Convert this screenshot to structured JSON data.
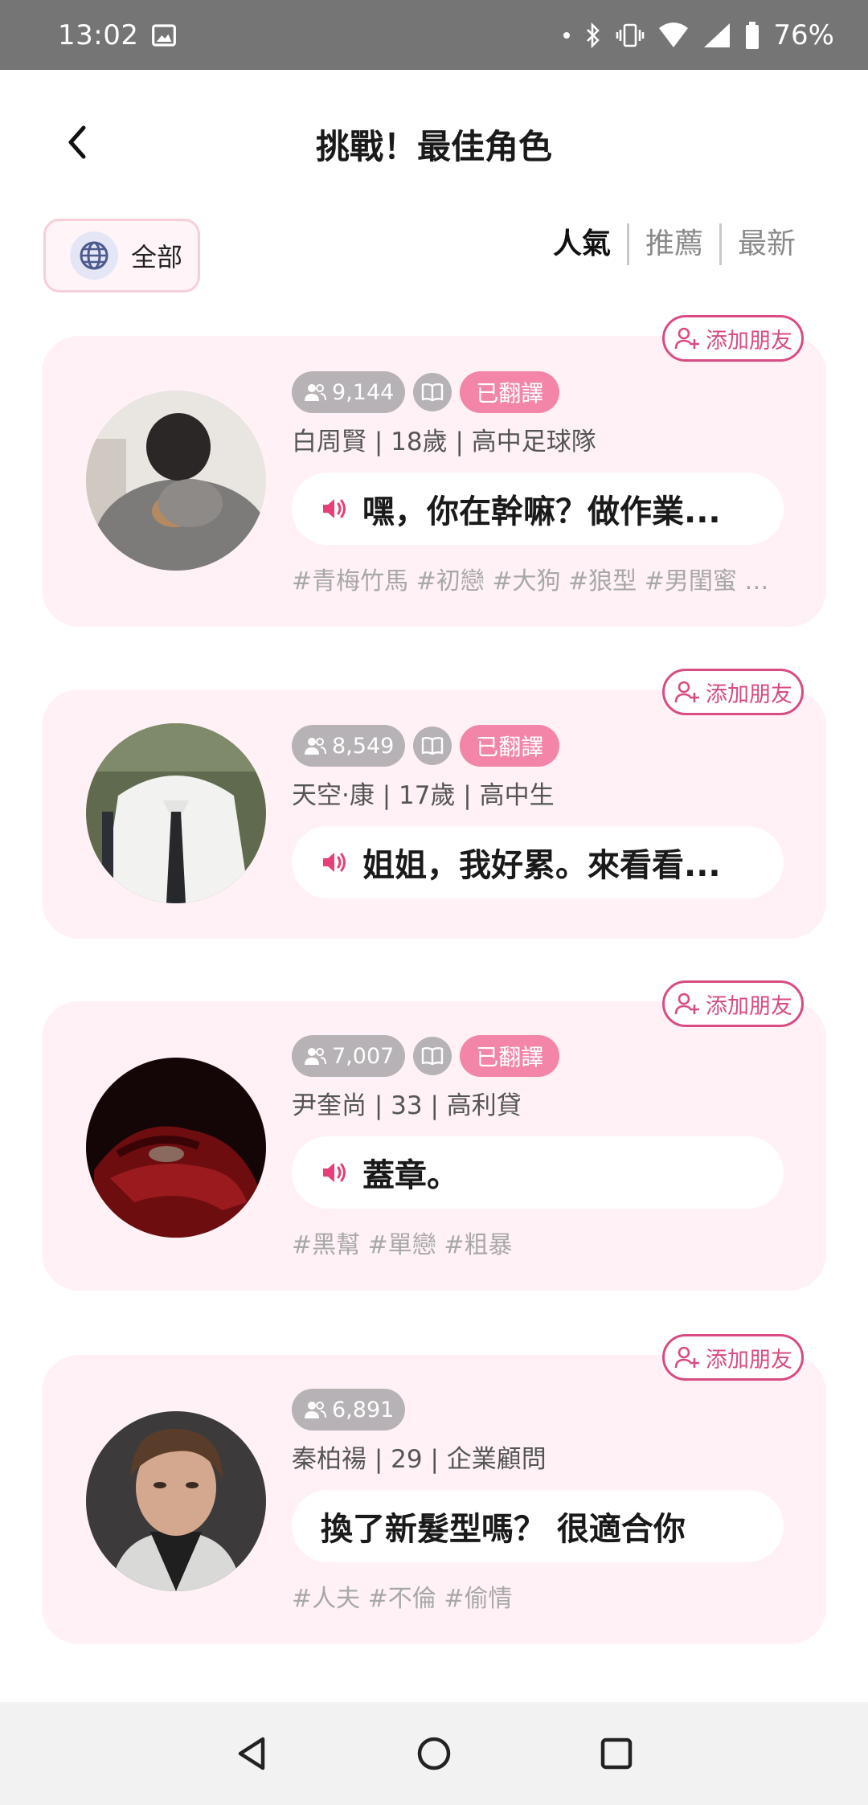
{
  "status_bar": {
    "time": "13:02",
    "battery": "76%",
    "icons": [
      "image-icon",
      "dot-icon",
      "bluetooth-icon",
      "vibrate-icon",
      "wifi-icon",
      "signal-icon",
      "battery-icon"
    ]
  },
  "header": {
    "title": "挑戰！最佳角色",
    "back_icon": "chevron-left-icon"
  },
  "filter": {
    "label": "全部",
    "icon": "globe-icon"
  },
  "sort_tabs": [
    {
      "label": "人氣",
      "active": true
    },
    {
      "label": "推薦",
      "active": false
    },
    {
      "label": "最新",
      "active": false
    }
  ],
  "colors": {
    "accent": "#d84b83",
    "card_bg": "#fff1f5",
    "translated_badge": "#f386a8",
    "count_badge": "#b7b2b5"
  },
  "characters": [
    {
      "add_friend_label": "添加朋友",
      "count": "9,144",
      "translated": true,
      "translated_label": "已翻譯",
      "profile": "白周賢 | 18歲 | 高中足球隊",
      "greeting": "嘿，你在幹嘛？做作業...",
      "has_audio": true,
      "tags": "#青梅竹馬 #初戀 #大狗 #狼型 #男閨蜜 #..."
    },
    {
      "add_friend_label": "添加朋友",
      "count": "8,549",
      "translated": true,
      "translated_label": "已翻譯",
      "profile": "天空·康 | 17歲 | 高中生",
      "greeting": "姐姐，我好累。來看看...",
      "has_audio": true,
      "tags": ""
    },
    {
      "add_friend_label": "添加朋友",
      "count": "7,007",
      "translated": true,
      "translated_label": "已翻譯",
      "profile": "尹奎尚 | 33 | 高利貸",
      "greeting": "蓋章。",
      "has_audio": true,
      "tags": "#黑幫 #單戀 #粗暴"
    },
    {
      "add_friend_label": "添加朋友",
      "count": "6,891",
      "translated": false,
      "translated_label": "",
      "profile": "秦柏禓 | 29 | 企業顧問",
      "greeting": "換了新髮型嗎？ 很適合你",
      "has_audio": false,
      "tags": "#人夫 #不倫 #偷情"
    }
  ],
  "nav_bar": {
    "icons": [
      "back-triangle-icon",
      "home-circle-icon",
      "recents-square-icon"
    ]
  }
}
